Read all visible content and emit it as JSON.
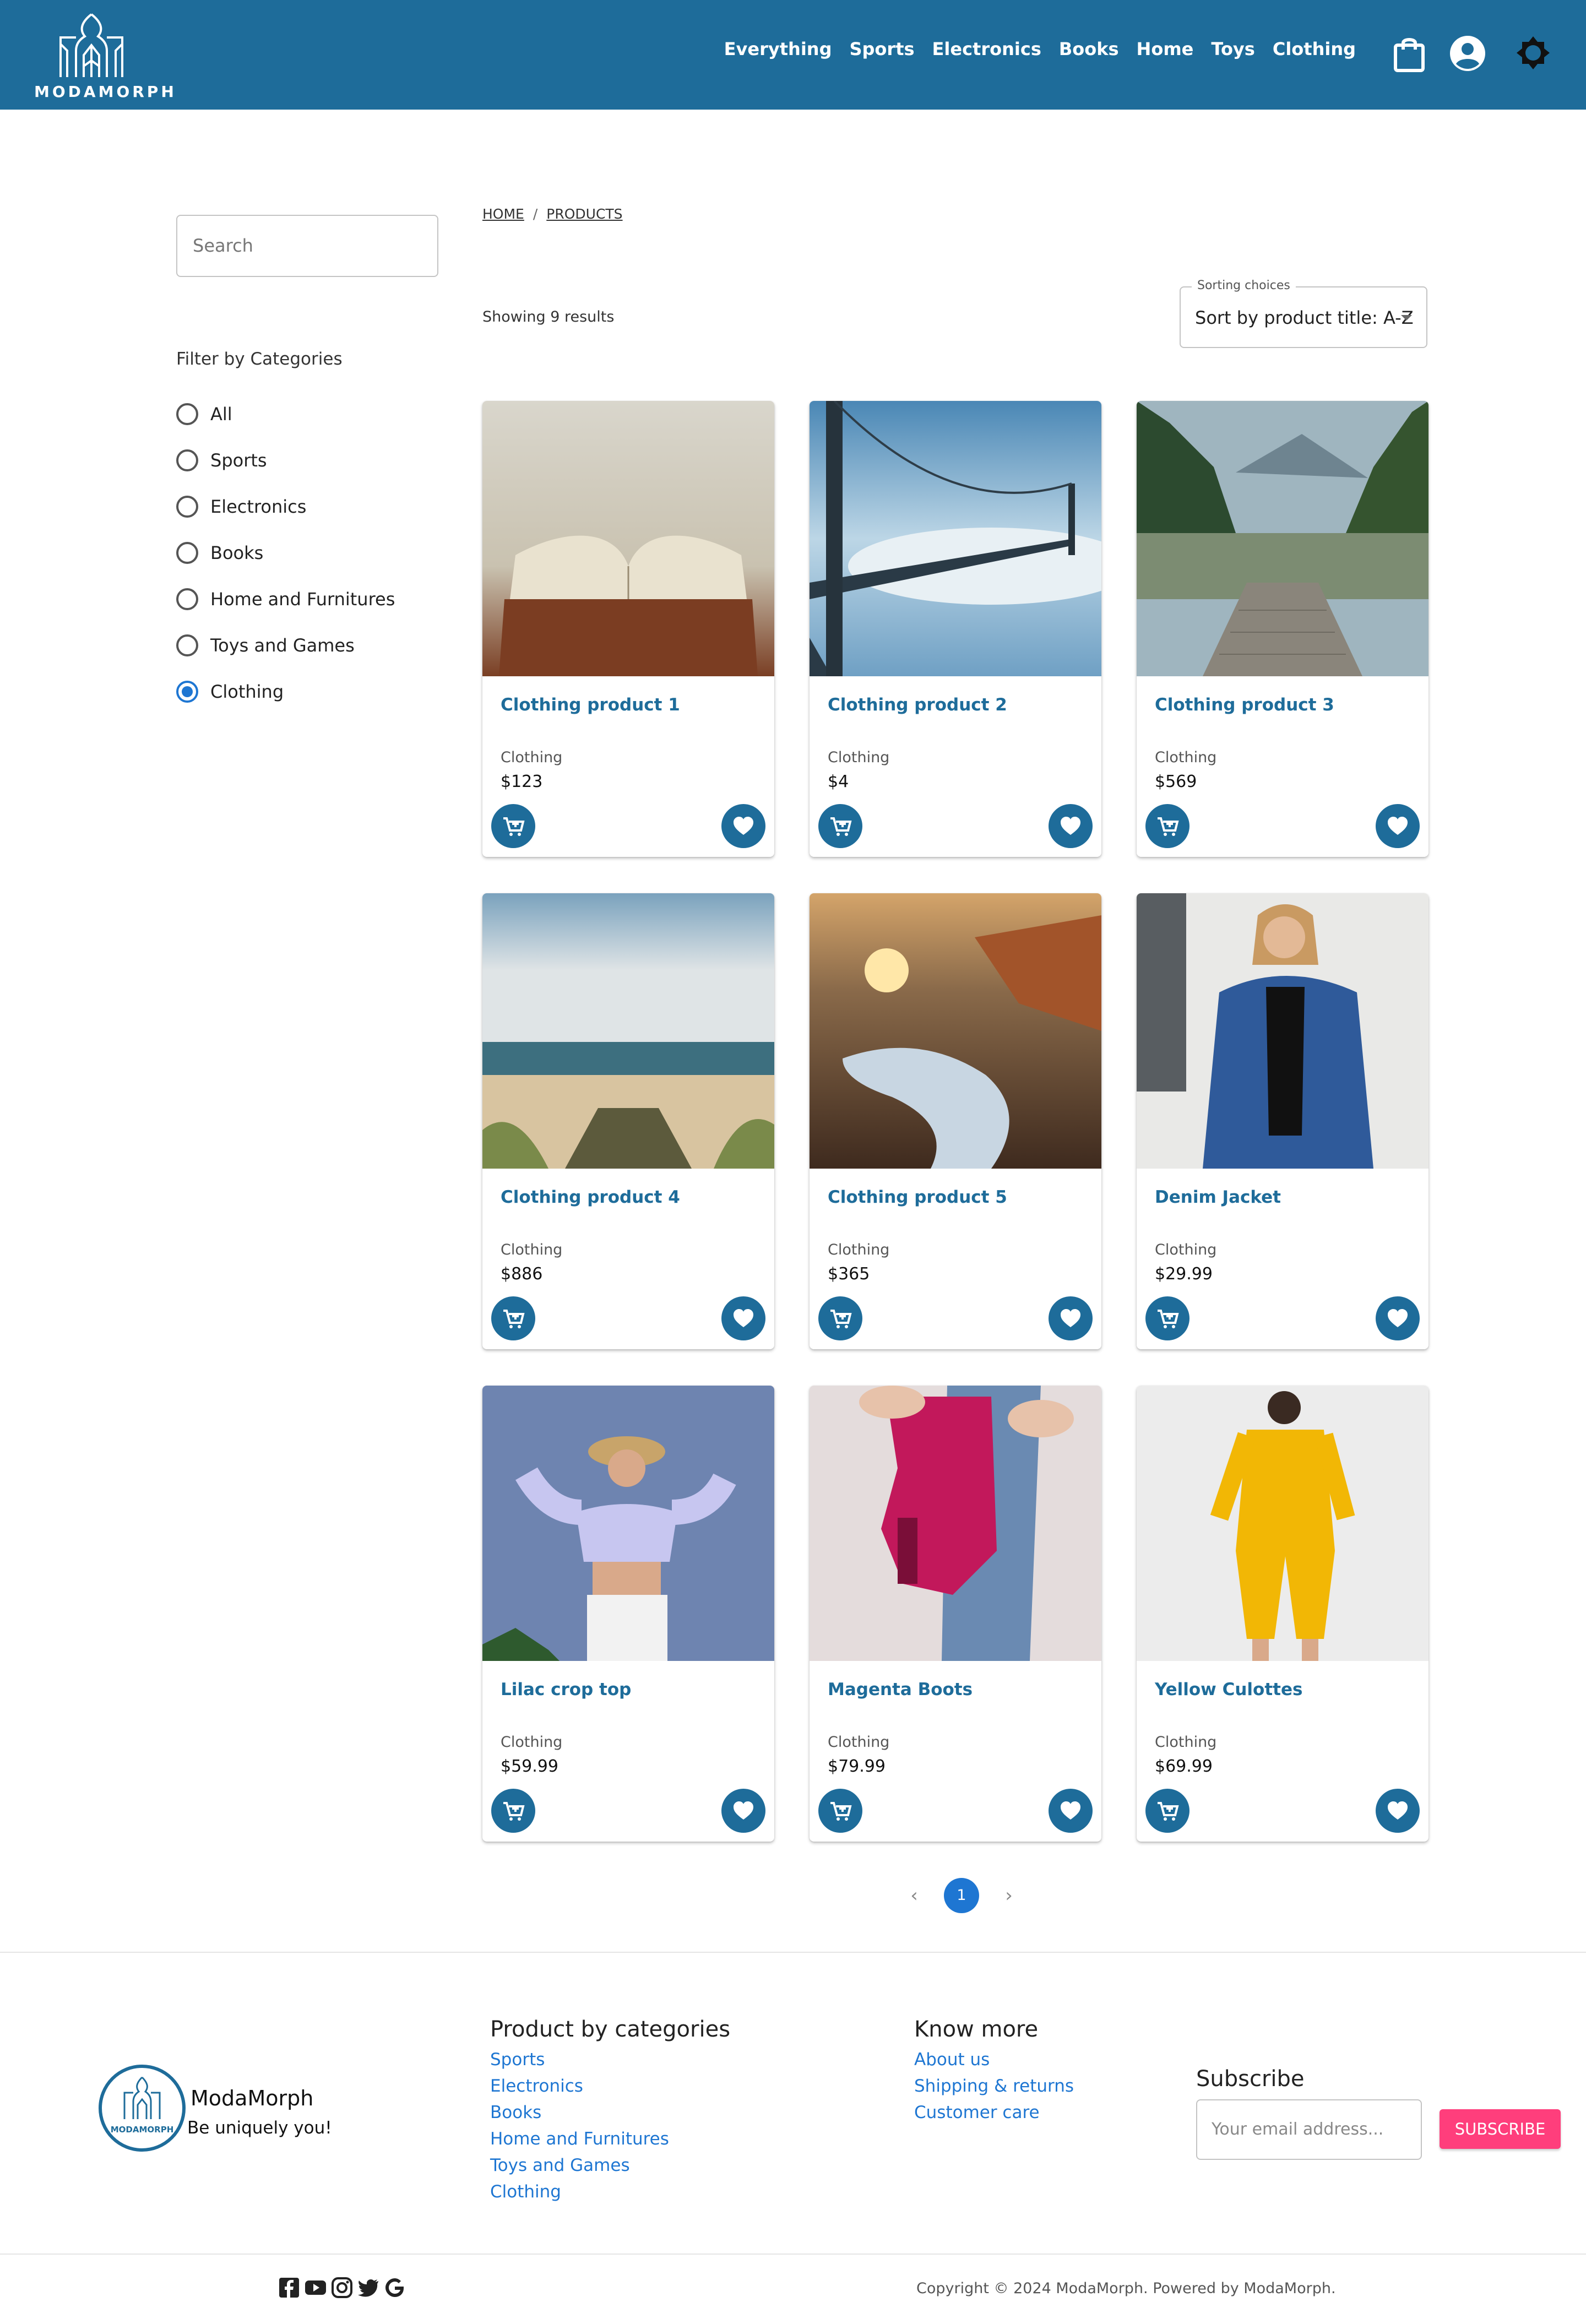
{
  "header": {
    "logo_text": "MODAMORPH",
    "nav": [
      "Everything",
      "Sports",
      "Electronics",
      "Books",
      "Home",
      "Toys",
      "Clothing"
    ],
    "bg_color": "#1e6c9a"
  },
  "sidebar": {
    "search_placeholder": "Search",
    "filter_title": "Filter by Categories",
    "categories": [
      {
        "label": "All",
        "checked": false
      },
      {
        "label": "Sports",
        "checked": false
      },
      {
        "label": "Electronics",
        "checked": false
      },
      {
        "label": "Books",
        "checked": false
      },
      {
        "label": "Home and Furnitures",
        "checked": false
      },
      {
        "label": "Toys and Games",
        "checked": false
      },
      {
        "label": "Clothing",
        "checked": true
      }
    ]
  },
  "main": {
    "breadcrumb": [
      "HOME",
      "PRODUCTS"
    ],
    "breadcrumb_sep": "/",
    "results_text": "Showing 9 results",
    "sort_legend": "Sorting choices",
    "sort_value": "Sort by product title: A-Z",
    "products": [
      {
        "title": "Clothing product 1",
        "category": "Clothing",
        "price": "$123"
      },
      {
        "title": "Clothing product 2",
        "category": "Clothing",
        "price": "$4"
      },
      {
        "title": "Clothing product 3",
        "category": "Clothing",
        "price": "$569"
      },
      {
        "title": "Clothing product 4",
        "category": "Clothing",
        "price": "$886"
      },
      {
        "title": "Clothing product 5",
        "category": "Clothing",
        "price": "$365"
      },
      {
        "title": "Denim Jacket",
        "category": "Clothing",
        "price": "$29.99"
      },
      {
        "title": "Lilac crop top",
        "category": "Clothing",
        "price": "$59.99"
      },
      {
        "title": "Magenta Boots",
        "category": "Clothing",
        "price": "$79.99"
      },
      {
        "title": "Yellow Culottes",
        "category": "Clothing",
        "price": "$69.99"
      }
    ],
    "pagination": {
      "prev": "‹",
      "current": "1",
      "next": "›"
    }
  },
  "footer": {
    "brand": "ModaMorph",
    "tagline": "Be uniquely you!",
    "logo_text": "MODAMORPH",
    "categories_title": "Product by categories",
    "categories": [
      "Sports",
      "Electronics",
      "Books",
      "Home and Furnitures",
      "Toys and Games",
      "Clothing"
    ],
    "know_title": "Know more",
    "know_links": [
      "About us",
      "Shipping & returns",
      "Customer care"
    ],
    "subscribe_title": "Subscribe",
    "email_placeholder": "Your email address...",
    "subscribe_button": "SUBSCRIBE",
    "copyright": "Copyright © 2024 ModaMorph. Powered by ModaMorph.",
    "socials": [
      "facebook-icon",
      "youtube-icon",
      "instagram-icon",
      "twitter-icon",
      "google-icon"
    ]
  },
  "colors": {
    "primary": "#1e6c9a",
    "accent": "#1e76d2",
    "subscribe": "#ff3e7c"
  }
}
